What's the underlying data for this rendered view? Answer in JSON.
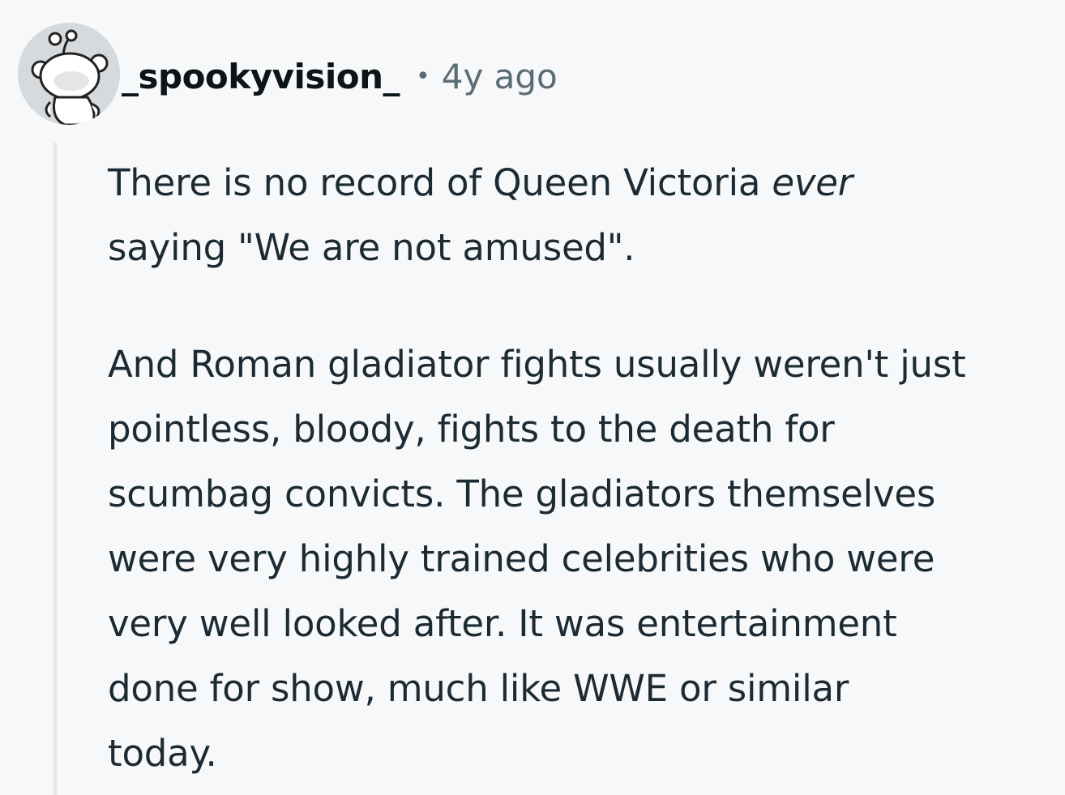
{
  "comment": {
    "author": "_spookyvision_",
    "separator": "•",
    "timestamp": "4y ago",
    "avatar_icon": "reddit-snoo-avatar-icon",
    "paragraphs": [
      {
        "lines": [
          [
            "There is no record of Queen Victoria ",
            "ever"
          ],
          [
            "saying \"We are not amused\"."
          ]
        ]
      },
      {
        "lines": [
          "And Roman gladiator fights usually weren't just",
          "pointless, bloody, fights to the death for",
          "scumbag convicts. The gladiators themselves",
          "were very highly trained celebrities who were",
          "very well looked after. It was entertainment",
          "done for show, much like WWE or similar",
          "today."
        ]
      }
    ]
  },
  "colors": {
    "background": "#f7f8fa",
    "text": "#1c2b33",
    "meta": "#5a6b75",
    "thread_line": "#e4e7ea"
  }
}
